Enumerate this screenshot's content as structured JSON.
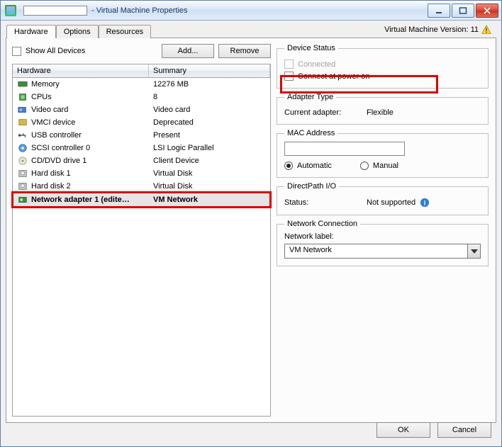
{
  "window": {
    "title_suffix": "- Virtual Machine Properties"
  },
  "tabs": [
    "Hardware",
    "Options",
    "Resources"
  ],
  "version_label": "Virtual Machine Version: 11",
  "toolbar": {
    "show_all_label": "Show All Devices",
    "add_label": "Add...",
    "remove_label": "Remove"
  },
  "columns": {
    "hardware": "Hardware",
    "summary": "Summary"
  },
  "devices": [
    {
      "icon": "memory",
      "name": "Memory",
      "summary": "12276 MB"
    },
    {
      "icon": "cpu",
      "name": "CPUs",
      "summary": "8"
    },
    {
      "icon": "video",
      "name": "Video card",
      "summary": "Video card"
    },
    {
      "icon": "vmci",
      "name": "VMCI device",
      "summary": "Deprecated"
    },
    {
      "icon": "usb",
      "name": "USB controller",
      "summary": "Present"
    },
    {
      "icon": "scsi",
      "name": "SCSI controller 0",
      "summary": "LSI Logic Parallel"
    },
    {
      "icon": "cd",
      "name": "CD/DVD drive 1",
      "summary": "Client Device"
    },
    {
      "icon": "disk",
      "name": "Hard disk 1",
      "summary": "Virtual Disk"
    },
    {
      "icon": "disk",
      "name": "Hard disk 2",
      "summary": "Virtual Disk"
    },
    {
      "icon": "nic",
      "name": "Network adapter 1 (edite…",
      "summary": "VM Network",
      "selected": true,
      "bold": true,
      "highlight": true
    }
  ],
  "device_status": {
    "legend": "Device Status",
    "connected_label": "Connected",
    "connect_power_label": "Connect at power on"
  },
  "adapter_type": {
    "legend": "Adapter Type",
    "current_label": "Current adapter:",
    "current_value": "Flexible"
  },
  "mac": {
    "legend": "MAC Address",
    "value": "",
    "auto_label": "Automatic",
    "manual_label": "Manual"
  },
  "directpath": {
    "legend": "DirectPath I/O",
    "status_label": "Status:",
    "status_value": "Not supported"
  },
  "netconn": {
    "legend": "Network Connection",
    "label": "Network label:",
    "value": "VM Network"
  },
  "footer": {
    "ok": "OK",
    "cancel": "Cancel"
  }
}
